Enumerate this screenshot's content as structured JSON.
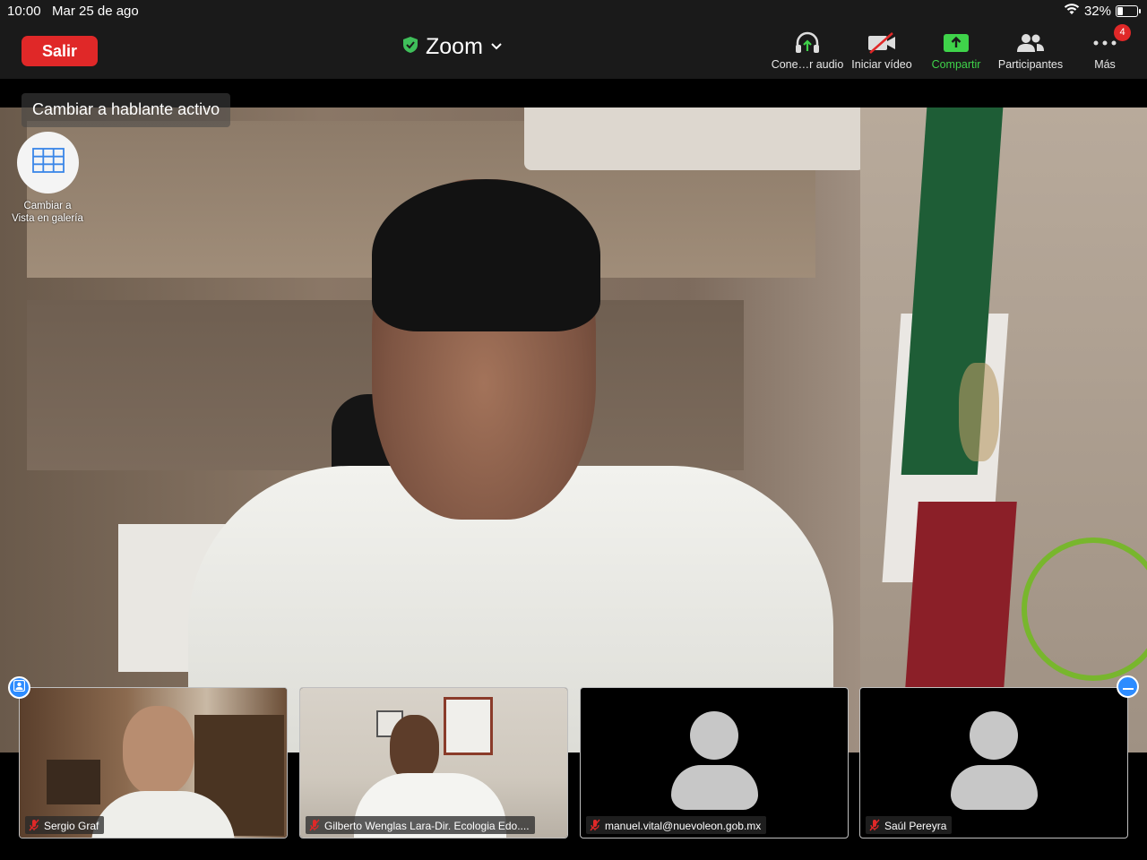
{
  "status_bar": {
    "time": "10:00",
    "date": "Mar 25 de ago",
    "battery_percent": "32%",
    "battery_level": 0.32
  },
  "toolbar": {
    "leave_label": "Salir",
    "meeting_title": "Zoom",
    "items": [
      {
        "label": "Cone…r audio",
        "icon": "headphones-icon"
      },
      {
        "label": "Iniciar vídeo",
        "icon": "video-off-icon"
      },
      {
        "label": "Compartir",
        "icon": "share-screen-icon"
      },
      {
        "label": "Participantes",
        "icon": "participants-icon"
      },
      {
        "label": "Más",
        "icon": "more-icon",
        "badge": "4"
      }
    ]
  },
  "view_controls": {
    "active_speaker_label": "Cambiar a hablante activo",
    "gallery_label_line1": "Cambiar a",
    "gallery_label_line2": "Vista en galería"
  },
  "participants": [
    {
      "name": "Sergio Graf",
      "video": true,
      "muted": true
    },
    {
      "name": "Gilberto Wenglas Lara-Dir. Ecologia Edo....",
      "video": true,
      "muted": true
    },
    {
      "name": "manuel.vital@nuevoleon.gob.mx",
      "video": false,
      "muted": true
    },
    {
      "name": "Saúl Pereyra",
      "video": false,
      "muted": true
    }
  ],
  "colors": {
    "leave_red": "#e02828",
    "share_green": "#3fd34a",
    "secure_green": "#3fbf5a",
    "accent_blue": "#2d8cff"
  }
}
